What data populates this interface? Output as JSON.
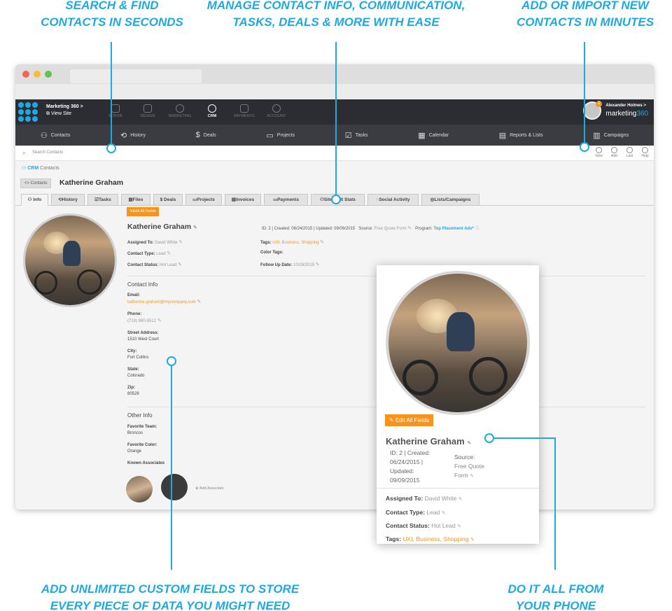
{
  "callouts": {
    "search": [
      "SEARCH & FIND",
      "CONTACTS IN SECONDS"
    ],
    "manage": [
      "MANAGE CONTACT INFO, COMMUNICATION,",
      "TASKS, DEALS & MORE WITH EASE"
    ],
    "add": [
      "ADD OR IMPORT NEW",
      "CONTACTS IN MINUTES"
    ],
    "custom": [
      "ADD UNLIMITED CUSTOM FIELDS TO STORE",
      "EVERY PIECE OF DATA YOU MIGHT NEED"
    ],
    "phone": [
      "DO IT ALL FROM",
      "YOUR PHONE"
    ]
  },
  "colors": {
    "accent": "#1fa9e1",
    "orange": "#f7941d",
    "topbar": "#2b2d33",
    "modnav": "#3a3c42"
  },
  "topbar": {
    "site_name": "Marketing 360 >",
    "view_site": "View Site",
    "apps": [
      {
        "label": "SCRIVE",
        "icon": "pen-icon"
      },
      {
        "label": "DESIGN",
        "icon": "design-icon"
      },
      {
        "label": "MARKETING",
        "icon": "pie-icon"
      },
      {
        "label": "CRM",
        "icon": "crm-icon"
      },
      {
        "label": "PAYMENTS",
        "icon": "card-icon"
      },
      {
        "label": "ACCOUNT",
        "icon": "gear-icon"
      }
    ],
    "user_name": "Alexander Holmes >",
    "notif_count": "2",
    "brand_a": "marketing",
    "brand_b": "360"
  },
  "modules": [
    {
      "label": "Contacts",
      "icon": "contacts-icon",
      "glyph": "⚇"
    },
    {
      "label": "History",
      "icon": "history-icon",
      "glyph": "⟲"
    },
    {
      "label": "Deals",
      "icon": "dollar-icon",
      "glyph": "$"
    },
    {
      "label": "Projects",
      "icon": "folder-icon",
      "glyph": "▭"
    },
    {
      "label": "Tasks",
      "icon": "check-icon",
      "glyph": "☑"
    },
    {
      "label": "Calendar",
      "icon": "calendar-icon",
      "glyph": "▦"
    },
    {
      "label": "Reports & Lists",
      "icon": "clipboard-icon",
      "glyph": "▤"
    },
    {
      "label": "Campaigns",
      "icon": "campaign-icon",
      "glyph": "▥"
    }
  ],
  "search": {
    "placeholder": "Search Contacts"
  },
  "tools": [
    {
      "label": "View",
      "icon": "view-icon"
    },
    {
      "label": "Add",
      "icon": "add-icon"
    },
    {
      "label": "Last",
      "icon": "last-icon"
    },
    {
      "label": "Help",
      "icon": "help-icon"
    }
  ],
  "breadcrumb": {
    "root": "CRM",
    "current": "Contacts"
  },
  "header": {
    "back": "<> Contacts",
    "name": "Katherine Graham"
  },
  "tabs": [
    "Info",
    "History",
    "Tasks",
    "Files",
    "Deals",
    "Projects",
    "Invoices",
    "Payments",
    "Site Visit Stats",
    "Social Activity",
    "Lists/Campaigns"
  ],
  "profile": {
    "edit_btn": "Edit All Fields",
    "name": "Katherine Graham",
    "id_line": "ID: 2 | Created: 06/24/2015 | Updated: 09/09/2015",
    "source_label": "Source:",
    "source_value": "Free Quote Form",
    "program_label": "Program:",
    "program_value": "Top Placement Ads*",
    "assigned_to_label": "Assigned To:",
    "assigned_to": "David White",
    "contact_type_label": "Contact Type:",
    "contact_type": "Lead",
    "contact_status_label": "Contact Status:",
    "contact_status": "Hot Lead",
    "tags_label": "Tags:",
    "tags": "UXI, Business, Shopping",
    "color_tags_label": "Color Tags:",
    "follow_up_label": "Follow Up Date:",
    "follow_up": "10/28/2015"
  },
  "contact_info": {
    "heading": "Contact Info",
    "email_label": "Email:",
    "email": "katherine.graham@mycompany.com",
    "phone_label": "Phone:",
    "phone": "(719) 980-5512",
    "street_label": "Street Address:",
    "street": "1510 West Court",
    "city_label": "City:",
    "city": "Fort Collins",
    "state_label": "State:",
    "state": "Colorado",
    "zip_label": "Zip:",
    "zip": "80528"
  },
  "other_info": {
    "heading": "Other Info",
    "team_label": "Favorite Team:",
    "team": "Broncos",
    "color_label": "Favorite Color:",
    "color": "Orange",
    "assoc_label": "Known Associates",
    "add_assoc": "Add Associate"
  },
  "phone_view": {
    "edit_btn": "Edit All Fields",
    "name": "Katherine Graham",
    "id_lines": [
      "ID: 2 | Created:",
      "06/24/2015 |",
      "Updated:",
      "09/09/2015"
    ],
    "source_lines": [
      "Source:",
      "Free Quote",
      "Form"
    ],
    "assigned_label": "Assigned To:",
    "assigned": "David White",
    "type_label": "Contact Type:",
    "type": "Lead",
    "status_label": "Contact Status:",
    "status": "Hot Lead",
    "tags_label": "Tags:",
    "tags": "UXI, Business, Shopping"
  }
}
